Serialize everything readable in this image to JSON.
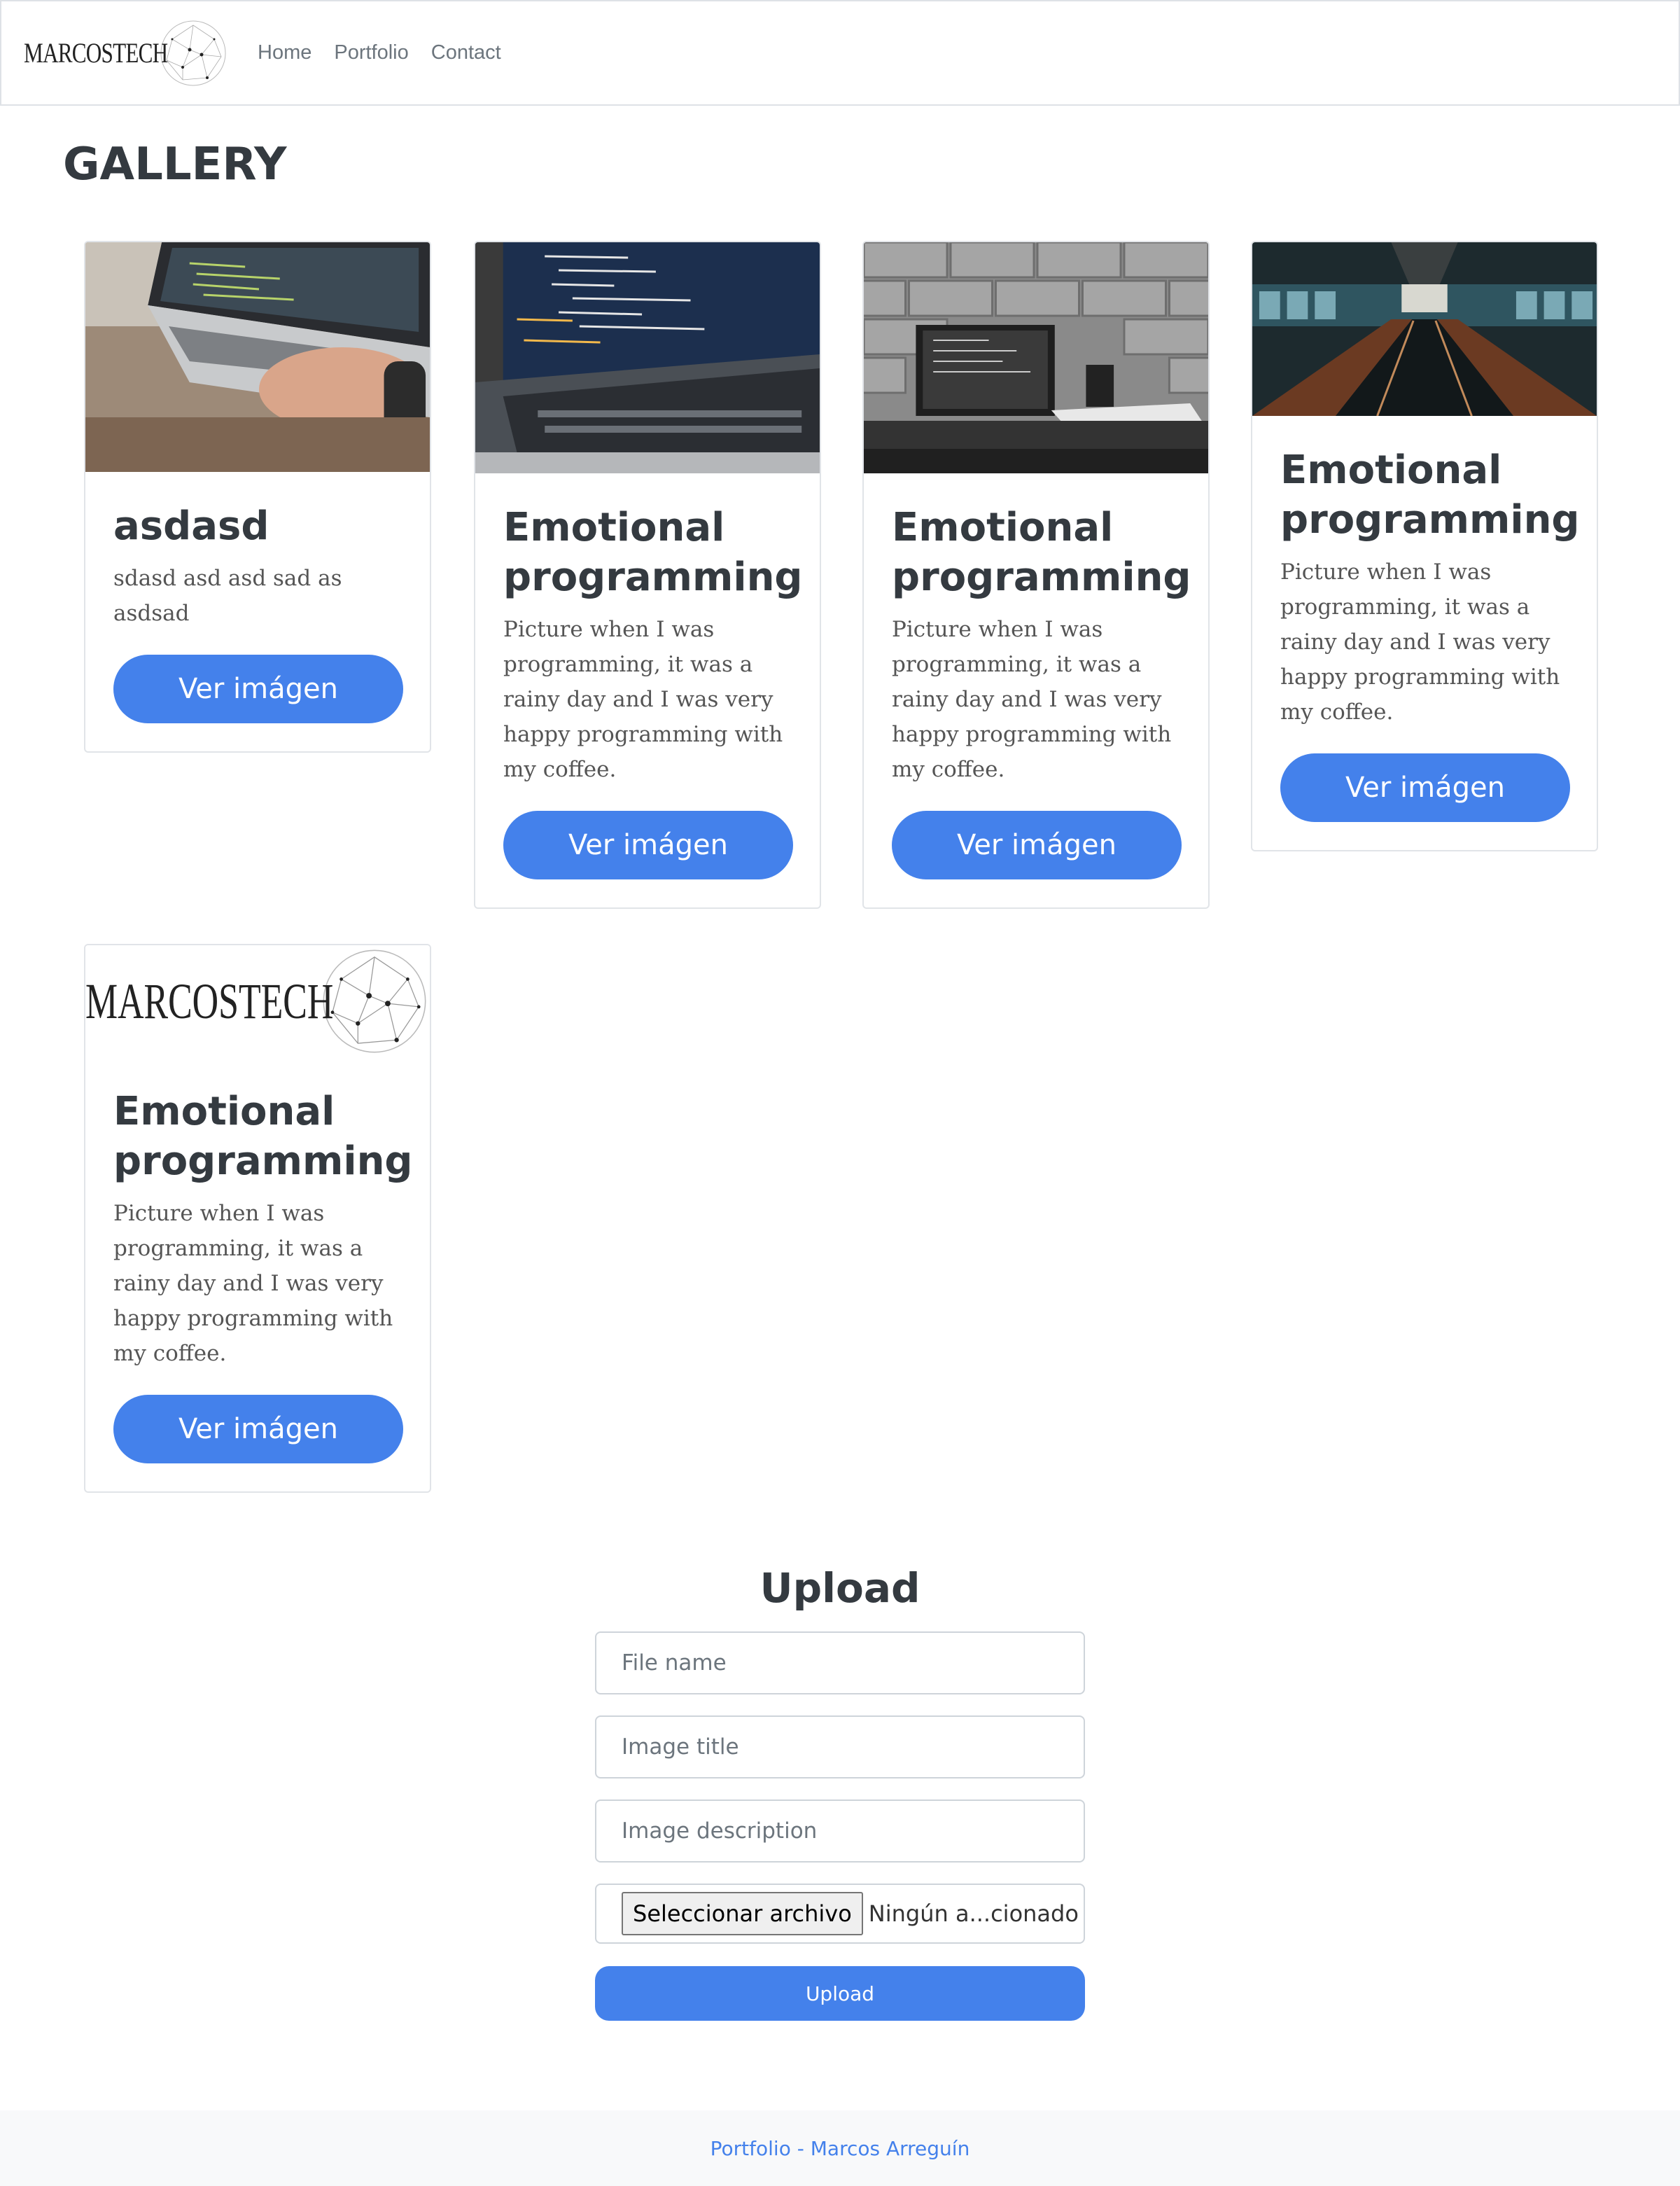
{
  "navbar": {
    "brand": "MARCOSTECH",
    "links": [
      "Home",
      "Portfolio",
      "Contact"
    ]
  },
  "gallery": {
    "title": "GALLERY",
    "cards": [
      {
        "image": "laptop-hand-typing-photo",
        "title": "asdasd",
        "text": "sdasd asd asd sad as asdsad",
        "button": "Ver imágen"
      },
      {
        "image": "laptop-code-screen-photo",
        "title": "Emotional programming",
        "text": "Picture when I was programming, it was a rainy day and I was very happy programming with my coffee.",
        "button": "Ver imágen"
      },
      {
        "image": "laptop-brick-wall-bw-photo",
        "title": "Emotional programming",
        "text": "Picture when I was programming, it was a rainy day and I was very happy programming with my coffee.",
        "button": "Ver imágen"
      },
      {
        "image": "escalator-building-photo",
        "title": "Emotional programming",
        "text": "Picture when I was programming, it was a rainy day and I was very happy programming with my coffee.",
        "button": "Ver imágen"
      },
      {
        "image": "marcostech-logo",
        "image_text": "MARCOSTECH",
        "title": "Emotional programming",
        "text": "Picture when I was programming, it was a rainy day and I was very happy programming with my coffee.",
        "button": "Ver imágen"
      }
    ]
  },
  "upload": {
    "title": "Upload",
    "file_name_placeholder": "File name",
    "image_title_placeholder": "Image title",
    "image_description_placeholder": "Image description",
    "file_button": "Seleccionar archivo",
    "file_status": "Ningún a...cionado",
    "submit": "Upload"
  },
  "footer": {
    "text": "Portfolio - Marcos Arreguín"
  },
  "colors": {
    "accent": "#4481eb",
    "heading": "#343a40",
    "nav_link": "#6c757d",
    "footer_bg": "#f8f9fa"
  }
}
